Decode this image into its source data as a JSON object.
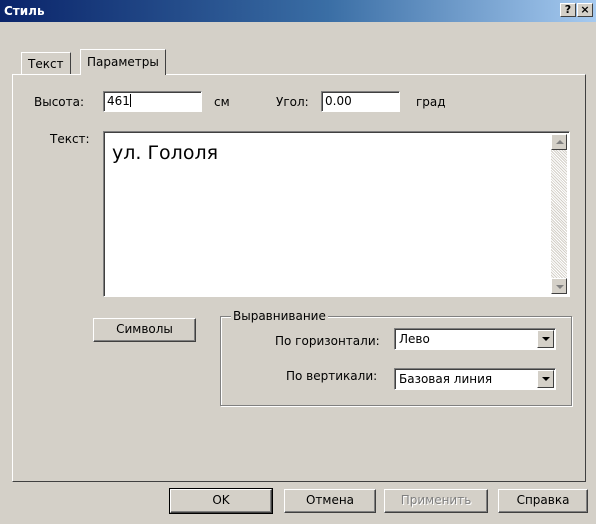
{
  "window": {
    "title": "Стиль",
    "help_label": "?",
    "close_label": "×"
  },
  "tabs": [
    {
      "label": "Текст",
      "active": false
    },
    {
      "label": "Параметры",
      "active": true
    }
  ],
  "params": {
    "height_label": "Высота:",
    "height_value": "461",
    "height_unit": "см",
    "angle_label": "Угол:",
    "angle_value": "0.00",
    "angle_unit": "град",
    "text_label": "Текст:",
    "text_value": "ул. Гололя"
  },
  "symbols_button": "Символы",
  "alignment": {
    "legend": "Выравнивание",
    "horizontal_label": "По горизонтали:",
    "horizontal_value": "Лево",
    "vertical_label": "По вертикали:",
    "vertical_value": "Базовая линия"
  },
  "footer": {
    "ok": "OK",
    "cancel": "Отмена",
    "apply": "Применить",
    "help": "Справка"
  },
  "colors": {
    "title_bar_start": "#0a246a",
    "title_bar_end": "#a6caf0",
    "face": "#d4d0c8"
  }
}
